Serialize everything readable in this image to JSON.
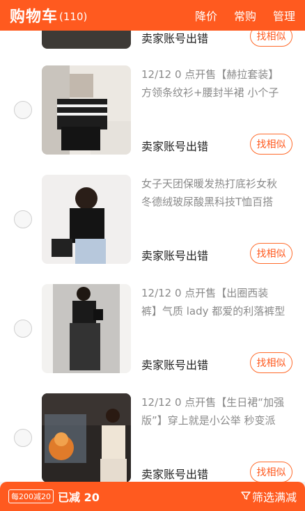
{
  "header": {
    "title": "购物车",
    "count": "(110)",
    "actions": [
      "降价",
      "常购",
      "管理"
    ]
  },
  "items": [
    {
      "desc_lines": [],
      "status": "卖家账号出错",
      "similar_label": "找相似"
    },
    {
      "desc_lines": [
        "12/12 0 点开售【赫拉套装】",
        "方领条纹衫+腰封半裙 小个子"
      ],
      "status": "卖家账号出错",
      "similar_label": "找相似"
    },
    {
      "desc_lines": [
        "女子天团保暖发热打底衫女秋",
        "冬德绒玻尿酸黑科技T恤百搭"
      ],
      "status": "卖家账号出错",
      "similar_label": "找相似"
    },
    {
      "desc_lines": [
        "12/12 0 点开售【出圈西装",
        "裤】气质 lady 都爱的利落裤型"
      ],
      "status": "卖家账号出错",
      "similar_label": "找相似"
    },
    {
      "desc_lines": [
        "12/12 0 点开售【生日裙“加强",
        "版”】穿上就是小公举 秒变派"
      ],
      "status": "卖家账号出错",
      "similar_label": "找相似"
    }
  ],
  "bottom": {
    "promo": "每200减20",
    "saved": "已减 20",
    "filter": "筛选满减"
  }
}
